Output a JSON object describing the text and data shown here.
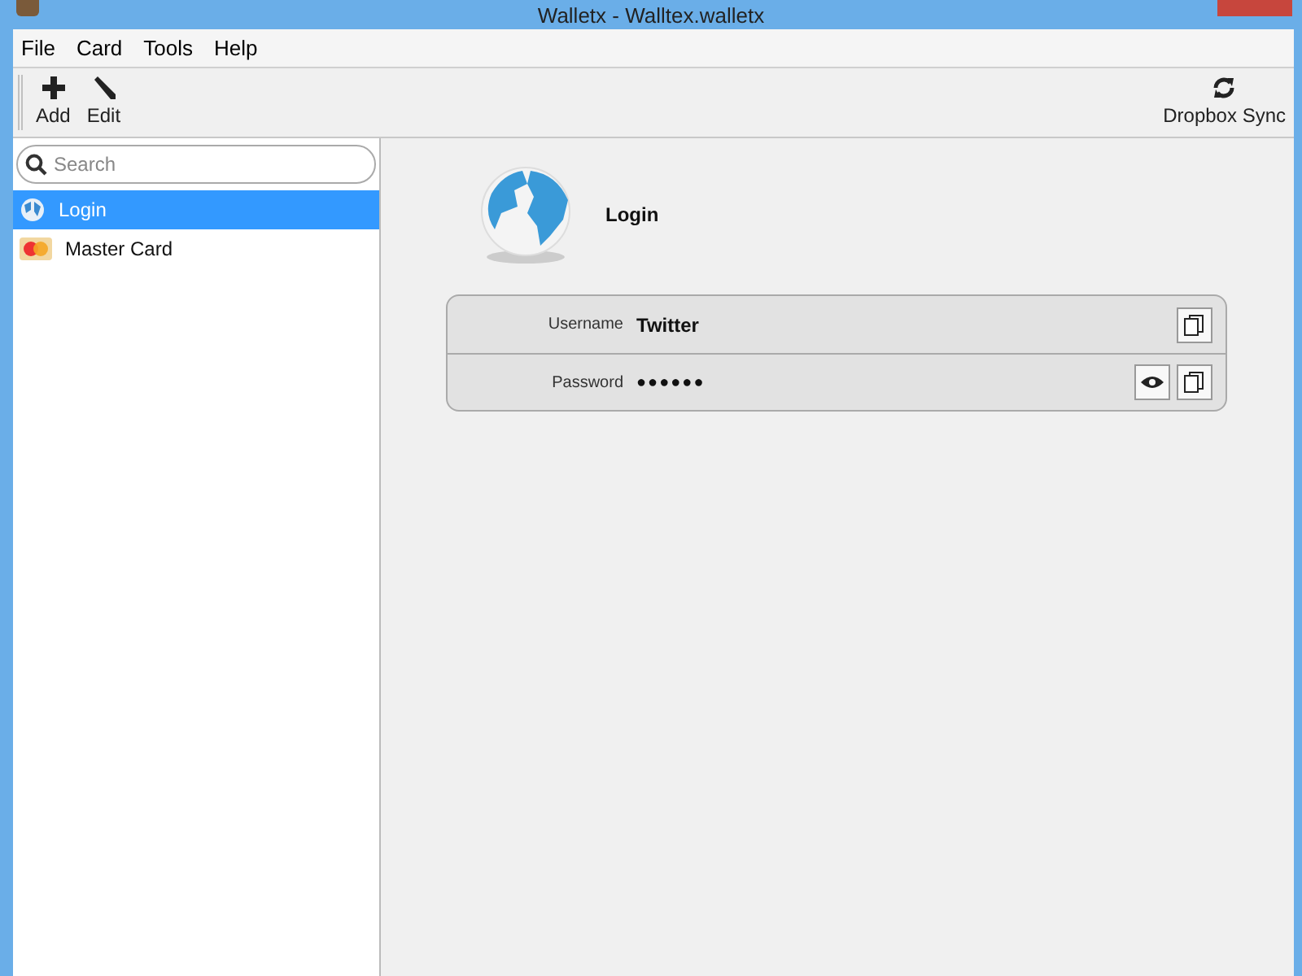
{
  "window": {
    "title": "Walletx - Walltex.walletx"
  },
  "menu": [
    "File",
    "Card",
    "Tools",
    "Help"
  ],
  "toolbar": [
    {
      "label": "Add",
      "kind": "add"
    },
    {
      "label": "Edit",
      "kind": "edit"
    }
  ],
  "sync_button": {
    "label": "Dropbox Sync"
  },
  "search": {
    "placeholder": "Search"
  },
  "cards": [
    {
      "label": "Login",
      "kind": "globe",
      "selected": true
    },
    {
      "label": "Master Card",
      "kind": "credit",
      "selected": false
    }
  ],
  "detail": {
    "title": "Login",
    "fields": [
      {
        "label": "Username",
        "value": "Twitter",
        "kind": "text"
      },
      {
        "label": "Password",
        "value": "●●●●●●",
        "kind": "secret"
      }
    ]
  }
}
